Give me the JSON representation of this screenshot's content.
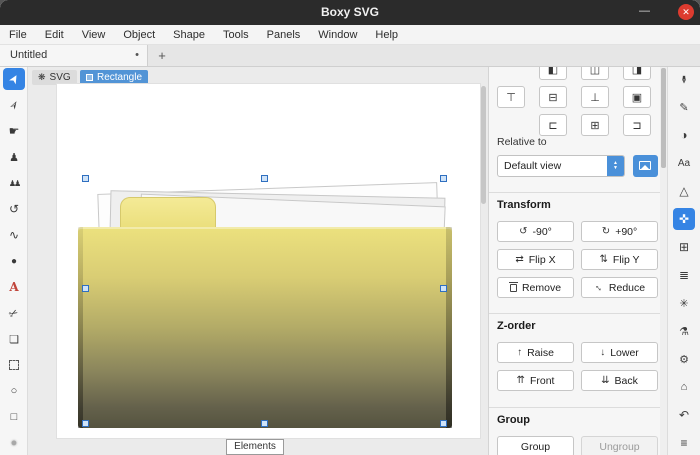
{
  "titlebar": {
    "title": "Boxy SVG",
    "minimize_glyph": "—",
    "close_glyph": "✕"
  },
  "menubar": {
    "items": [
      "File",
      "Edit",
      "View",
      "Object",
      "Shape",
      "Tools",
      "Panels",
      "Window",
      "Help"
    ]
  },
  "tabbar": {
    "tab_label": "Untitled",
    "modified_dot": "•",
    "new_tab_glyph": "+"
  },
  "breadcrumb": {
    "svg_icon_glyph": "❋",
    "svg_label": "SVG",
    "rect_label": "Rectangle"
  },
  "toolbar": {
    "tools": [
      {
        "name": "transform-tool",
        "glyph": "➤",
        "active": true
      },
      {
        "name": "edit-tool",
        "glyph": "➢"
      },
      {
        "name": "pan-tool",
        "glyph": "☛"
      },
      {
        "name": "freehand-tool",
        "glyph": "♟"
      },
      {
        "name": "multiselect-tool",
        "glyph": "♟♟"
      },
      {
        "name": "rotate-tool",
        "glyph": "↺"
      },
      {
        "name": "curve-tool",
        "glyph": "∿"
      },
      {
        "name": "blob-tool",
        "glyph": "●"
      },
      {
        "name": "text-tool",
        "glyph": "A"
      },
      {
        "name": "cut-tool",
        "glyph": "✂"
      },
      {
        "name": "view-tool",
        "glyph": "❏"
      },
      {
        "name": "marquee-tool",
        "glyph": ""
      },
      {
        "name": "ellipse-tool",
        "glyph": "○"
      },
      {
        "name": "rect-tool",
        "glyph": "□"
      },
      {
        "name": "blur-tool",
        "glyph": "●"
      }
    ]
  },
  "canvas": {
    "elements_label": "Elements"
  },
  "panel": {
    "align": {
      "row1": [
        {
          "name": "align-left-edges",
          "glyph": "◧"
        },
        {
          "name": "align-center-horizontal",
          "glyph": "◫"
        },
        {
          "name": "align-right-edges",
          "glyph": "◨"
        }
      ],
      "row2": [
        {
          "name": "align-top-edges",
          "glyph": "⊤"
        },
        {
          "name": "align-middle",
          "glyph": "⊟"
        },
        {
          "name": "align-bottom-edges",
          "glyph": "⊥"
        },
        {
          "name": "align-center",
          "glyph": "▣"
        }
      ],
      "row3": [
        {
          "name": "distribute-horizontal",
          "glyph": "⊏"
        },
        {
          "name": "distribute-center",
          "glyph": "⊞"
        },
        {
          "name": "distribute-vertical",
          "glyph": "⊐"
        }
      ]
    },
    "relative_to": {
      "label": "Relative to",
      "value": "Default view",
      "spin_up": "▲",
      "spin_down": "▼"
    },
    "transform": {
      "heading": "Transform",
      "buttons": [
        {
          "glyph": "↺",
          "label": "-90°"
        },
        {
          "glyph": "↻",
          "label": "+90°"
        },
        {
          "glyph": "⇄",
          "label": "Flip X"
        },
        {
          "glyph": "⇅",
          "label": "Flip Y"
        },
        {
          "glyph": "",
          "label": "Remove"
        },
        {
          "glyph": "↔",
          "label": "Reduce"
        }
      ]
    },
    "zorder": {
      "heading": "Z-order",
      "buttons": [
        {
          "glyph": "↑",
          "label": "Raise"
        },
        {
          "glyph": "↓",
          "label": "Lower"
        },
        {
          "glyph": "⇈",
          "label": "Front"
        },
        {
          "glyph": "⇊",
          "label": "Back"
        }
      ]
    },
    "group": {
      "heading": "Group",
      "buttons": [
        {
          "label": "Group",
          "disabled": false
        },
        {
          "label": "Ungroup",
          "disabled": true
        }
      ]
    }
  },
  "strip": {
    "icons": [
      {
        "name": "color-picker",
        "glyph": "✒"
      },
      {
        "name": "paint",
        "glyph": "✎"
      },
      {
        "name": "compositing",
        "glyph": "◑"
      },
      {
        "name": "typography",
        "glyph": "Aa"
      },
      {
        "name": "geometry",
        "glyph": "△"
      },
      {
        "name": "arrangement",
        "glyph": "✜",
        "active": true
      },
      {
        "name": "objects",
        "glyph": "⊞"
      },
      {
        "name": "elements",
        "glyph": "≣"
      },
      {
        "name": "defs",
        "glyph": "✳"
      },
      {
        "name": "generators",
        "glyph": "⚗"
      },
      {
        "name": "settings",
        "glyph": "⚙"
      },
      {
        "name": "home",
        "glyph": "⌂"
      },
      {
        "name": "history",
        "glyph": "↶"
      },
      {
        "name": "menu",
        "glyph": "≡"
      }
    ]
  },
  "colors": {
    "accent": "#3584e4",
    "close_red": "#dd3b2f",
    "selection_blue": "#2f6fc0",
    "folder_top": "#ece17e",
    "folder_bottom": "#55533f"
  }
}
